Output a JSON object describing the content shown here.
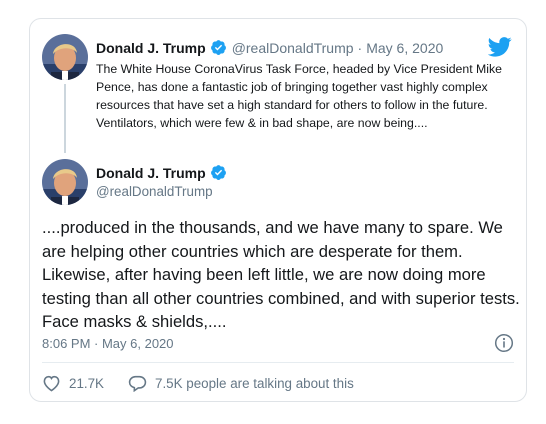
{
  "quoted_tweet": {
    "author_name": "Donald J. Trump",
    "handle": "@realDonaldTrump",
    "separator": "·",
    "date": "May 6, 2020",
    "text": "The White House CoronaVirus Task Force, headed by Vice President Mike Pence, has done a fantastic job of bringing together vast highly complex resources that have set a high standard for others to follow in the future. Ventilators, which were few & in bad shape, are now being...."
  },
  "main_tweet": {
    "author_name": "Donald J. Trump",
    "handle": "@realDonaldTrump",
    "text": "....produced in the thousands, and we have many to spare. We are helping other countries which are desperate for them. Likewise, after having been left little, we are now doing more testing than all other countries combined, and with superior tests. Face masks & shields,....",
    "timestamp": "8:06 PM · May 6, 2020"
  },
  "actions": {
    "likes": "21.7K",
    "replies_text": "7.5K people are talking about this"
  },
  "icons": {
    "brand": "twitter-bird-icon",
    "verified": "verified-badge-icon",
    "info": "info-icon",
    "like": "heart-icon",
    "reply": "speech-bubble-icon"
  },
  "colors": {
    "brand_blue": "#1da1f2",
    "secondary_text": "#657786",
    "border": "#dfe3e7"
  }
}
